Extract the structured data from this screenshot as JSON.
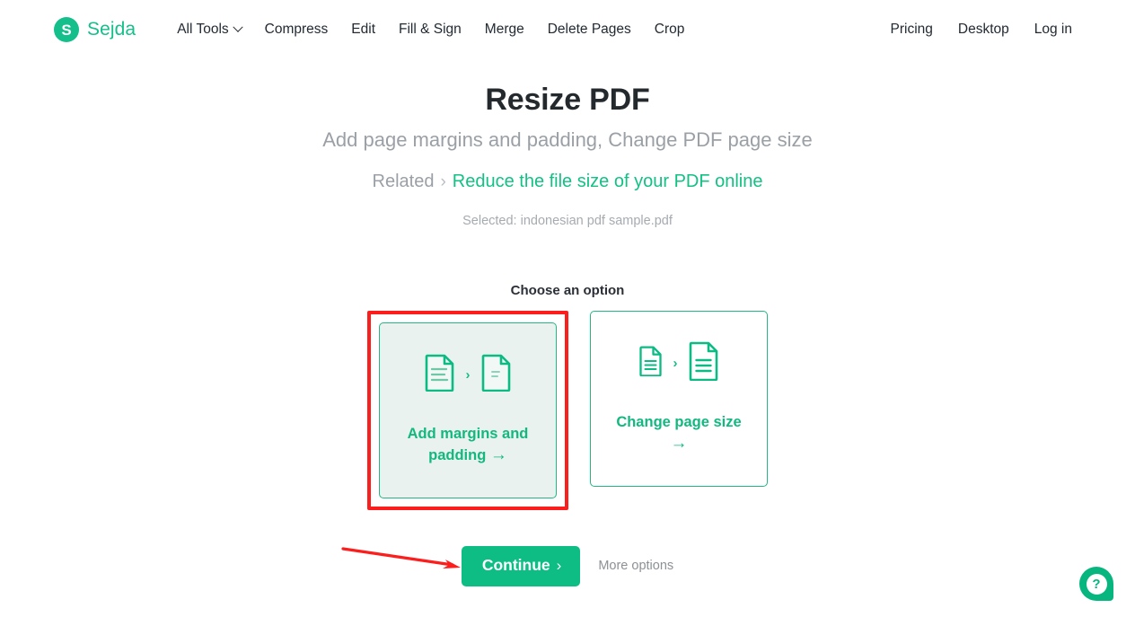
{
  "brand": {
    "mark": "S",
    "name": "Sejda"
  },
  "nav": {
    "left": [
      {
        "label": "All Tools",
        "has_chevron": true
      },
      {
        "label": "Compress",
        "has_chevron": false
      },
      {
        "label": "Edit",
        "has_chevron": false
      },
      {
        "label": "Fill & Sign",
        "has_chevron": false
      },
      {
        "label": "Merge",
        "has_chevron": false
      },
      {
        "label": "Delete Pages",
        "has_chevron": false
      },
      {
        "label": "Crop",
        "has_chevron": false
      }
    ],
    "right": [
      {
        "label": "Pricing"
      },
      {
        "label": "Desktop"
      },
      {
        "label": "Log in"
      }
    ]
  },
  "hero": {
    "title": "Resize PDF",
    "subtitle": "Add page margins and padding, Change PDF page size",
    "related_label": "Related",
    "related_separator": "›",
    "related_link": "Reduce the file size of your PDF online",
    "selected_file": "Selected: indonesian pdf sample.pdf"
  },
  "options": {
    "heading": "Choose an option",
    "cards": [
      {
        "label": "Add margins and padding",
        "arrow": "→",
        "selected": true,
        "highlighted": true,
        "icon_left": "document-many-lines-icon",
        "icon_separator": "›",
        "icon_right": "document-few-lines-icon"
      },
      {
        "label": "Change page size",
        "arrow": "→",
        "selected": false,
        "highlighted": false,
        "icon_left": "document-small-icon",
        "icon_separator": "›",
        "icon_right": "document-large-icon"
      }
    ]
  },
  "cta": {
    "continue_label": "Continue",
    "continue_chevron": "›",
    "more_options_label": "More options"
  },
  "help": {
    "glyph": "?"
  },
  "colors": {
    "brand_green": "#14bf8b",
    "link_green": "#13c184",
    "button_green": "#0dbd84",
    "card_border": "#22b783",
    "card_selected_bg": "#e9f2ee",
    "annotation_red": "#fc1d1d",
    "muted_text": "#9aa0a6",
    "title_text": "#24292e"
  }
}
